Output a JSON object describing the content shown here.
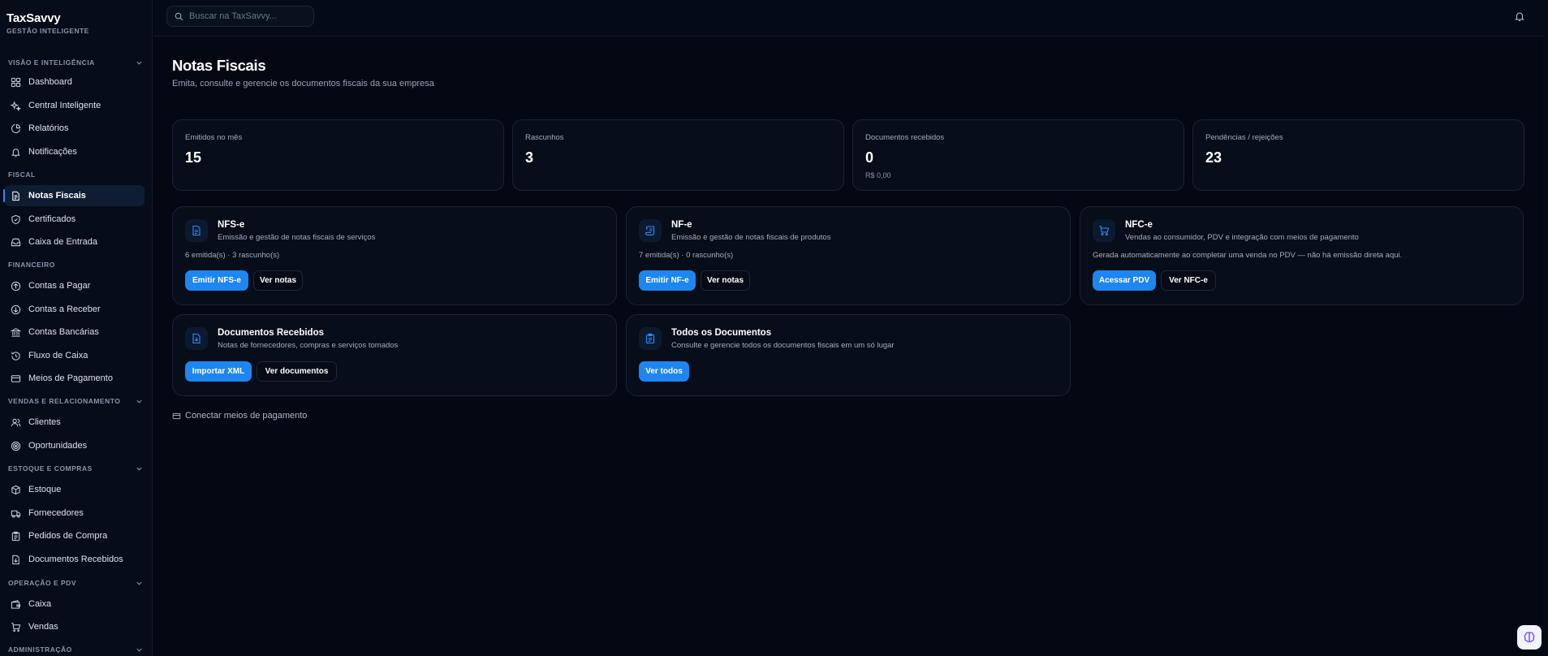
{
  "brand": {
    "name": "TaxSavvy",
    "subtitle": "GESTÃO INTELIGENTE"
  },
  "search": {
    "placeholder": "Buscar na TaxSavvy..."
  },
  "sidebar": {
    "sections": [
      {
        "label": "VISÃO E INTELIGÊNCIA",
        "collapsible": true
      },
      {
        "label": "FISCAL",
        "collapsible": false
      },
      {
        "label": "FINANCEIRO",
        "collapsible": false
      },
      {
        "label": "VENDAS E RELACIONAMENTO",
        "collapsible": true
      },
      {
        "label": "ESTOQUE E COMPRAS",
        "collapsible": true
      },
      {
        "label": "OPERAÇÃO E PDV",
        "collapsible": true
      },
      {
        "label": "ADMINISTRAÇÃO",
        "collapsible": true
      }
    ],
    "items": [
      {
        "label": "Dashboard",
        "icon": "grid-icon"
      },
      {
        "label": "Central Inteligente",
        "icon": "sparkles-icon"
      },
      {
        "label": "Relatórios",
        "icon": "pie-chart-icon"
      },
      {
        "label": "Notificações",
        "icon": "bell-icon"
      },
      {
        "label": "Notas Fiscais",
        "icon": "file-text-icon",
        "active": true
      },
      {
        "label": "Certificados",
        "icon": "shield-check-icon"
      },
      {
        "label": "Caixa de Entrada",
        "icon": "inbox-icon"
      },
      {
        "label": "Contas a Pagar",
        "icon": "arrow-up-circle-icon"
      },
      {
        "label": "Contas a Receber",
        "icon": "arrow-down-circle-icon"
      },
      {
        "label": "Contas Bancárias",
        "icon": "bank-icon"
      },
      {
        "label": "Fluxo de Caixa",
        "icon": "history-icon"
      },
      {
        "label": "Meios de Pagamento",
        "icon": "credit-card-icon"
      },
      {
        "label": "Clientes",
        "icon": "users-icon"
      },
      {
        "label": "Oportunidades",
        "icon": "target-icon"
      },
      {
        "label": "Estoque",
        "icon": "package-icon"
      },
      {
        "label": "Fornecedores",
        "icon": "truck-icon"
      },
      {
        "label": "Pedidos de Compra",
        "icon": "clipboard-icon"
      },
      {
        "label": "Documentos Recebidos",
        "icon": "file-import-icon"
      },
      {
        "label": "Caixa",
        "icon": "wallet-icon"
      },
      {
        "label": "Vendas",
        "icon": "shopping-cart-icon"
      }
    ]
  },
  "header": {
    "title": "Notas Fiscais",
    "subtitle": "Emita, consulte e gerencie os documentos fiscais da sua empresa"
  },
  "stats": [
    {
      "label": "Emitidos no mês",
      "value": "15"
    },
    {
      "label": "Rascunhos",
      "value": "3"
    },
    {
      "label": "Documentos recebidos",
      "value": "0",
      "extra": "R$ 0,00"
    },
    {
      "label": "Pendências / rejeições",
      "value": "23"
    }
  ],
  "cards": {
    "nfse": {
      "title": "NFS-e",
      "desc": "Emissão e gestão de notas fiscais de serviços",
      "meta": "6 emitida(s) · 3 rascunho(s)",
      "primary": "Emitir NFS-e",
      "secondary": "Ver notas",
      "icon": "file-text-icon"
    },
    "nfe": {
      "title": "NF-e",
      "desc": "Emissão e gestão de notas fiscais de produtos",
      "meta": "7 emitida(s) · 0 rascunho(s)",
      "primary": "Emitir NF-e",
      "secondary": "Ver notas",
      "icon": "scroll-icon"
    },
    "nfce": {
      "title": "NFC-e",
      "desc": "Vendas ao consumidor, PDV e integração com meios de pagamento",
      "meta": "Gerada automaticamente ao completar uma venda no PDV — não há emissão direta aqui.",
      "primary": "Acessar PDV",
      "secondary": "Ver NFC-e",
      "icon": "shopping-cart-icon"
    },
    "received": {
      "title": "Documentos Recebidos",
      "desc": "Notas de fornecedores, compras e serviços tomados",
      "primary": "Importar XML",
      "secondary": "Ver documentos",
      "icon": "file-import-icon"
    },
    "all": {
      "title": "Todos os Documentos",
      "desc": "Consulte e gerencie todos os documentos fiscais em um só lugar",
      "primary": "Ver todos",
      "icon": "clipboard-list-icon"
    }
  },
  "connect_link": "Conectar meios de pagamento",
  "colors": {
    "accent": "#1d86f0",
    "background": "#030813",
    "card": "#070d19",
    "border": "#1b2434"
  }
}
